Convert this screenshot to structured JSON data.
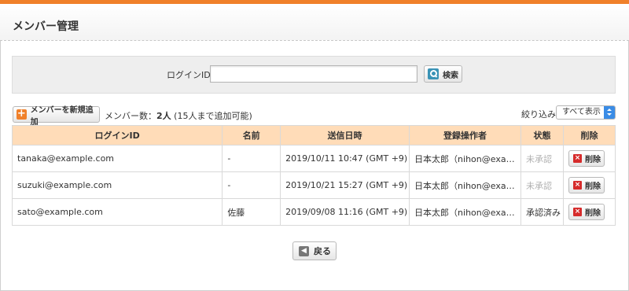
{
  "header": {
    "title": "メンバー管理"
  },
  "search": {
    "label": "ログインID",
    "value": "",
    "placeholder": "",
    "button_label": "検索",
    "button_icon": "search-icon"
  },
  "toolbar": {
    "add_label": "メンバーを新規追加",
    "add_icon": "plus-icon",
    "count_prefix": "メンバー数：",
    "count_value": "2人",
    "count_note": "(15人まで追加可能)",
    "filter_label": "絞り込み",
    "filter_selected": "すべて表示"
  },
  "table": {
    "headers": [
      "ログインID",
      "名前",
      "送信日時",
      "登録操作者",
      "状態",
      "削除"
    ],
    "rows": [
      {
        "login_id": "tanaka@example.com",
        "name": "-",
        "sent": "2019/10/11 10:47 (GMT +9)",
        "operator": "日本太郎（nihon@exam…",
        "status": "未承認",
        "delete_label": "削除"
      },
      {
        "login_id": "suzuki@example.com",
        "name": "-",
        "sent": "2019/10/21 15:27 (GMT +9)",
        "operator": "日本太郎（nihon@exam…",
        "status": "未承認",
        "delete_label": "削除"
      },
      {
        "login_id": "sato@example.com",
        "name": "佐藤",
        "sent": "2019/09/08 11:16 (GMT +9)",
        "operator": "日本太郎（nihon@exam…",
        "status": "承認済み",
        "delete_label": "削除"
      }
    ]
  },
  "footer": {
    "back_label": "戻る",
    "back_icon": "back-arrow-icon"
  },
  "colors": {
    "accent": "#f0802a",
    "table_header": "#ffdcb8",
    "delete_icon": "#d62b2b",
    "search_icon": "#3a93b6"
  }
}
